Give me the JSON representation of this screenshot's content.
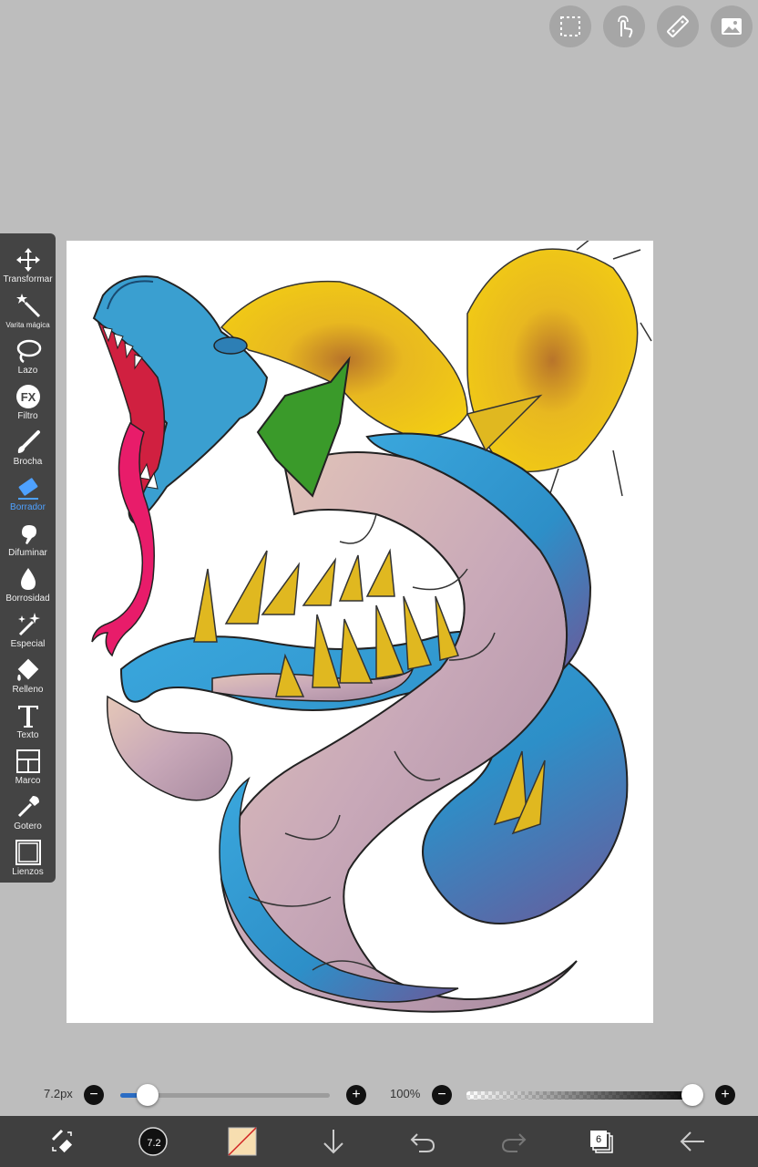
{
  "toolbar_top": {
    "icons": [
      "selection-icon",
      "gesture-icon",
      "ruler-icon",
      "image-icon"
    ]
  },
  "tools": [
    {
      "label": "Transformar",
      "icon": "move-icon"
    },
    {
      "label": "Varita mágica",
      "icon": "magic-wand-icon"
    },
    {
      "label": "Lazo",
      "icon": "lasso-icon"
    },
    {
      "label": "Filtro",
      "icon": "fx-icon"
    },
    {
      "label": "Brocha",
      "icon": "brush-icon"
    },
    {
      "label": "Borrador",
      "icon": "eraser-icon",
      "active": true
    },
    {
      "label": "Difuminar",
      "icon": "smudge-icon"
    },
    {
      "label": "Borrosidad",
      "icon": "blur-drop-icon"
    },
    {
      "label": "Especial",
      "icon": "sparkle-icon"
    },
    {
      "label": "Relleno",
      "icon": "fill-bucket-icon"
    },
    {
      "label": "Texto",
      "icon": "text-icon"
    },
    {
      "label": "Marco",
      "icon": "frame-icon"
    },
    {
      "label": "Gotero",
      "icon": "eyedropper-icon"
    },
    {
      "label": "Lienzos",
      "icon": "canvas-icon"
    }
  ],
  "brush_size": {
    "value_label": "7.2px",
    "fraction": 0.06
  },
  "opacity": {
    "value_label": "100%",
    "fraction": 1.0
  },
  "bottom_bar": {
    "brush_badge": "7.2",
    "layers_count": "6",
    "icons": [
      "swap-tool-icon",
      "brush-size-icon",
      "color-swatch-icon",
      "download-icon",
      "undo-icon",
      "redo-icon",
      "layers-icon",
      "back-arrow-icon"
    ]
  },
  "colors": {
    "accent": "#4ea1ff",
    "panel": "#444444",
    "background": "#bdbdbd",
    "bottombar": "#3f3f3f",
    "swatch": "#f7deb0"
  }
}
